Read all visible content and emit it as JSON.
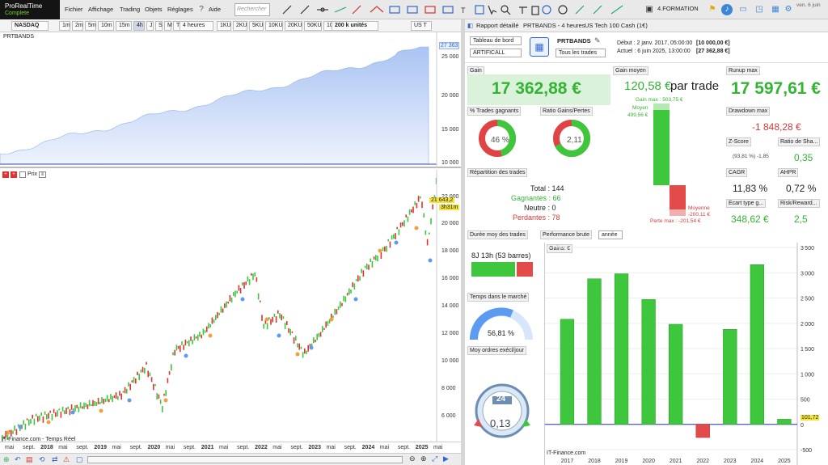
{
  "app": {
    "name": "ProRealTime",
    "edition": "Complete"
  },
  "menu": [
    "Fichier",
    "Affichage",
    "Trading",
    "Objets",
    "Réglages",
    "Aide"
  ],
  "search_placeholder": "Rechercher",
  "workspace": "4.FORMATION",
  "clock": {
    "line1": "ven. 6 juin"
  },
  "toolbar2": {
    "symbol": "NASDAQ",
    "timeframes": [
      "1m",
      "2m",
      "5m",
      "10m",
      "15m",
      "4h",
      "J",
      "S",
      "M",
      "T",
      "A"
    ],
    "period": "4 heures",
    "ticks": [
      "1KU",
      "2KU",
      "5KU",
      "10KU",
      "20KU",
      "50KU",
      "100KU"
    ],
    "units": "200 k unités",
    "market": "US T"
  },
  "pane1": {
    "title": "PRTBANDS",
    "ticks": [
      "25 000",
      "20 000",
      "15 000",
      "10 000"
    ],
    "last": "27 363"
  },
  "pane2": {
    "title": "Prix",
    "ticks": [
      "22 000",
      "20 000",
      "18 000",
      "16 000",
      "14 000",
      "12 000",
      "10 000",
      "8 000",
      "6 000"
    ],
    "last_price": "21 643,2",
    "countdown": "3h31m"
  },
  "xaxis": {
    "labels": [
      "mai",
      "sept.",
      "2018",
      "mai",
      "sept.",
      "2019",
      "mai",
      "sept.",
      "2020",
      "mai",
      "sept.",
      "2021",
      "mai",
      "sept.",
      "2022",
      "mai",
      "sept.",
      "2023",
      "mai",
      "sept.",
      "2024",
      "mai",
      "sept.",
      "2025",
      "mai"
    ],
    "source": "IT-Finance.com - Temps Réel"
  },
  "report": {
    "tabs": [
      "Rapport détaillé",
      "PRTBANDS - 4 heures",
      "US Tech 100 Cash (1€)"
    ],
    "dashboard": "Tableau de bord",
    "asset": "ARTIFICALL",
    "system": "PRTBANDS",
    "trades_filter": "Tous les trades",
    "start": "Début :  2 janv. 2017, 05:00:00",
    "start_val": "[10 000,00 €]",
    "end": "Actuel :   6 juin 2025, 13:00:00",
    "end_val": "[27 362,88 €]",
    "gain_label": "Gain",
    "gain": "17 362,88 €",
    "avg_gain_label": "Gain moyen",
    "avg_gain": "120,58 €",
    "per_trade": "par trade",
    "gain_max": "Gain max : 503,75 €",
    "moyen": "Moyen",
    "moyen_val": "499,56 €",
    "moyenne": "Moyenne",
    "moyenne_val": "-200,11 €",
    "perte_max": "Perte max : -201,54 €",
    "runup_label": "Runup max",
    "runup": "17 597,61 €",
    "drawdown_label": "Drawdown max",
    "drawdown": "-1 848,28 €",
    "pct_label": "% Trades gagnants",
    "pct": "46 %",
    "ratio_label": "Ratio Gains/Pertes",
    "ratio": "2,11",
    "zscore_label": "Z-Score",
    "zscore_sub": "(93,81 %) -1,85",
    "sharpe_label": "Ratio de Sha...",
    "sharpe": "0,35",
    "cagr_label": "CAGR",
    "cagr": "11,83 %",
    "ahpr_label": "AHPR",
    "ahpr": "0,72 %",
    "std_label": "Ecart type g...",
    "std": "348,62 €",
    "rr_label": "Risk/Reward...",
    "rr": "2,5",
    "rep_label": "Répartition des trades",
    "total": "Total : 144",
    "gagnantes": "Gagnantes : 66",
    "neutre": "Neutre : 0",
    "perdantes": "Perdantes : 78",
    "duree_label": "Durée moy des trades",
    "duree": "8J 13h (53 barres)",
    "perf_label": "Performance brute",
    "perf_period": "année",
    "temps_label": "Temps dans le marché",
    "temps": "56,81 %",
    "moy_ordres_label": "Moy ordres exécl/jour",
    "moy_ordres": "0,13",
    "clock_24": "24",
    "gains_label": "Gains: €",
    "source": "IT-Finance.com",
    "last_bar": "101,72"
  },
  "chart_data": {
    "type": "bar",
    "title": "Gains: €",
    "categories": [
      "2017",
      "2018",
      "2019",
      "2020",
      "2021",
      "2022",
      "2023",
      "2024",
      "2025"
    ],
    "values": [
      2080,
      2880,
      2980,
      2470,
      1980,
      -260,
      1880,
      3160,
      102
    ],
    "ylim": [
      -500,
      3500
    ],
    "yticks": [
      3500,
      3000,
      2500,
      2000,
      1500,
      1000,
      500,
      0,
      -500
    ]
  }
}
